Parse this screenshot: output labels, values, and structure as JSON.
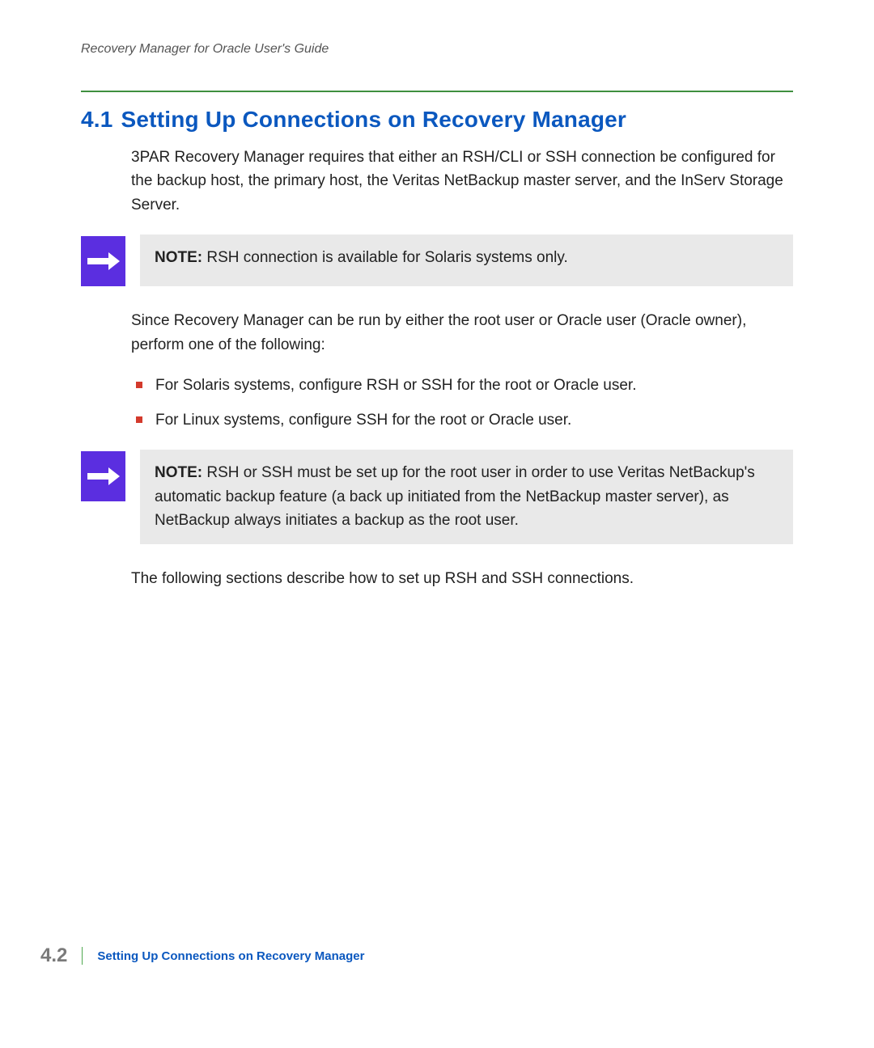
{
  "running_head": "Recovery Manager for Oracle User's Guide",
  "section": {
    "number": "4.1",
    "title": "Setting Up Connections on Recovery Manager"
  },
  "intro": "3PAR Recovery Manager requires that either an RSH/CLI or SSH connection be configured for the backup host, the primary host, the Veritas NetBackup master server, and the InServ Storage Server.",
  "note1": {
    "label": "NOTE:",
    "text": "RSH connection is available for Solaris systems only."
  },
  "since_para": "Since Recovery Manager can be run by either the root user or Oracle user (Oracle owner), perform one of the following:",
  "bullets": [
    "For Solaris systems, configure RSH or SSH for the root or Oracle user.",
    "For Linux systems, configure SSH for the root or Oracle user."
  ],
  "note2": {
    "label": "NOTE:",
    "text": "RSH or SSH must be set up for the root user in order to use Veritas NetBackup's automatic backup feature (a back up initiated from the NetBackup master server), as NetBackup always initiates a backup as the root user."
  },
  "closing": "The following sections describe how to set up RSH and SSH connections.",
  "footer": {
    "page_number": "4.2",
    "title": "Setting Up Connections on Recovery Manager"
  }
}
